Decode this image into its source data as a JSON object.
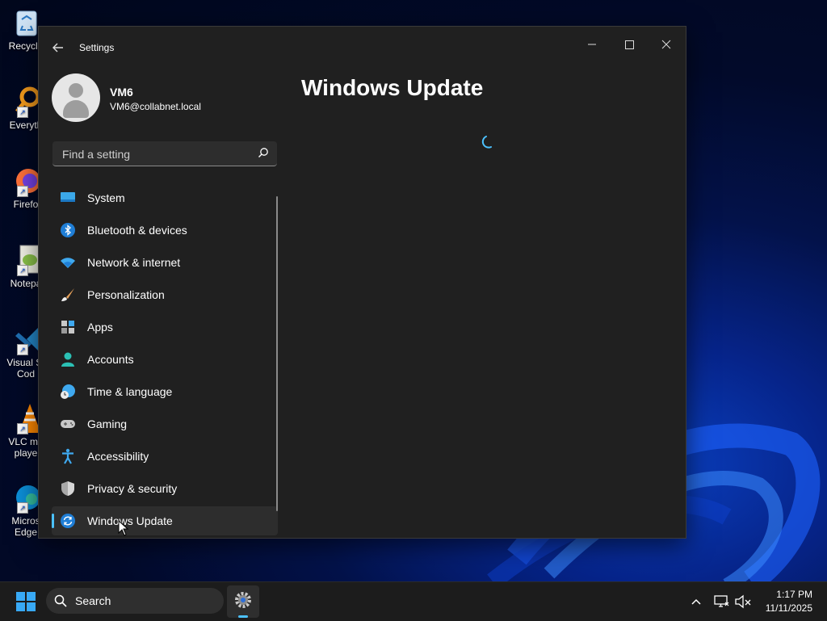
{
  "desktop": {
    "icons": [
      {
        "label": "Recycle",
        "icon": "recycle-bin-icon"
      },
      {
        "label": "Everyth",
        "icon": "everything-search-icon"
      },
      {
        "label": "Firefo",
        "icon": "firefox-icon"
      },
      {
        "label": "Notepa",
        "icon": "notepad-plus-plus-icon"
      },
      {
        "label": "Visual St\nCod",
        "icon": "vscode-icon"
      },
      {
        "label": "VLC me\nplaye",
        "icon": "vlc-icon"
      },
      {
        "label": "Micros\nEdge",
        "icon": "edge-icon"
      }
    ]
  },
  "window": {
    "title": "Settings",
    "back_icon": "back-arrow-icon",
    "controls": {
      "minimize": "—",
      "maximize": "☐",
      "close": "✕"
    }
  },
  "profile": {
    "name": "VM6",
    "email": "VM6@collabnet.local"
  },
  "search": {
    "placeholder": "Find a setting"
  },
  "nav": {
    "items": [
      {
        "label": "System",
        "icon": "system-monitor-icon"
      },
      {
        "label": "Bluetooth & devices",
        "icon": "bluetooth-icon"
      },
      {
        "label": "Network & internet",
        "icon": "wifi-icon"
      },
      {
        "label": "Personalization",
        "icon": "paintbrush-icon"
      },
      {
        "label": "Apps",
        "icon": "apps-grid-icon"
      },
      {
        "label": "Accounts",
        "icon": "account-person-icon"
      },
      {
        "label": "Time & language",
        "icon": "globe-clock-icon"
      },
      {
        "label": "Gaming",
        "icon": "gamepad-icon"
      },
      {
        "label": "Accessibility",
        "icon": "accessibility-icon"
      },
      {
        "label": "Privacy & security",
        "icon": "shield-icon"
      },
      {
        "label": "Windows Update",
        "icon": "update-sync-icon",
        "selected": true
      }
    ]
  },
  "main": {
    "title": "Windows Update",
    "loading": true
  },
  "taskbar": {
    "search_label": "Search",
    "pinned_app": "settings-gear-icon",
    "clock": {
      "time": "1:17 PM",
      "date": "11/11/2025"
    }
  },
  "colors": {
    "accent": "#4cc2ff",
    "window_bg": "#202020",
    "taskbar_bg": "#1c1c1c"
  }
}
